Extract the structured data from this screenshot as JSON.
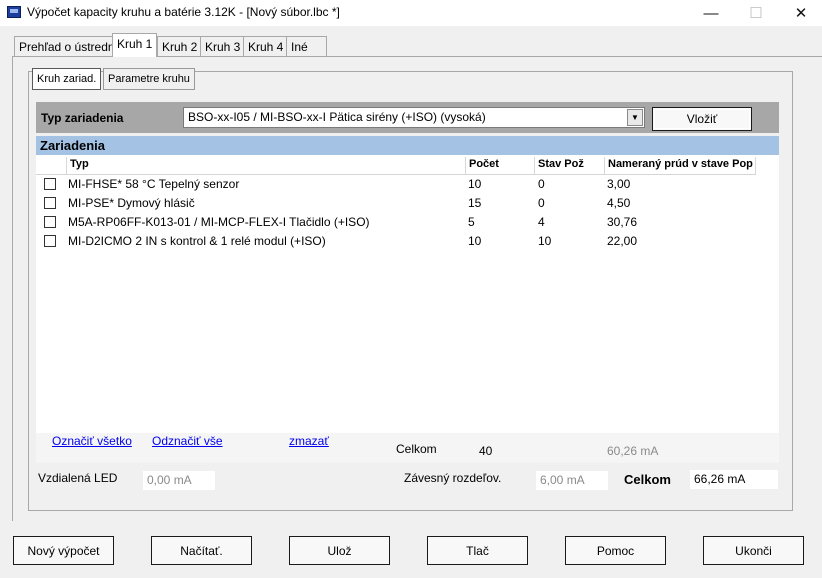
{
  "window": {
    "title": "Výpočet kapacity kruhu a batérie 3.12K - [Nový súbor.lbc *]",
    "min": "—",
    "max": "☐",
    "close": "✕"
  },
  "tabs": [
    "Prehľad o ústredni",
    "Kruh 1",
    "Kruh 2",
    "Kruh 3",
    "Kruh 4",
    "Iné"
  ],
  "subtabs": [
    "Kruh zariad.",
    "Parametre kruhu"
  ],
  "device_type": {
    "label": "Typ zariadenia",
    "selected": "BSO-xx-I05 / MI-BSO-xx-I  Pätica sirény (+ISO) (vysoká)",
    "insert_button": "Vložiť"
  },
  "devices": {
    "title": "Zariadenia",
    "columns": [
      "Typ",
      "Počet",
      "Stav Pož",
      "Nameraný prúd v stave Pop"
    ],
    "rows": [
      [
        "MI-FHSE* 58 °C Tepelný senzor",
        "10",
        "0",
        "3,00"
      ],
      [
        "MI-PSE* Dymový hlásič",
        "15",
        "0",
        "4,50"
      ],
      [
        "M5A-RP06FF-K013-01 / MI-MCP-FLEX-I Tlačidlo (+ISO)",
        "5",
        "4",
        "30,76"
      ],
      [
        "MI-D2ICMO 2 IN s kontrol & 1 relé modul (+ISO)",
        "10",
        "10",
        "22,00"
      ]
    ]
  },
  "footer": {
    "select_all": "Označiť všetko",
    "deselect_all": "Odznačiť vše",
    "delete": "zmazať",
    "total_label": "Celkom",
    "total_count": "40",
    "total_current": "60,26 mA",
    "remote_led_label": "Vzdialená LED",
    "remote_led_value": "0,00 mA",
    "hanging_label": "Závesný rozdeľov.",
    "hanging_value": "6,00 mA",
    "grand_total_label": "Celkom",
    "grand_total_value": "66,26 mA"
  },
  "buttons": [
    "Nový výpočet",
    "Načítať.",
    "Ulož",
    "Tlač",
    "Pomoc",
    "Ukonči"
  ]
}
